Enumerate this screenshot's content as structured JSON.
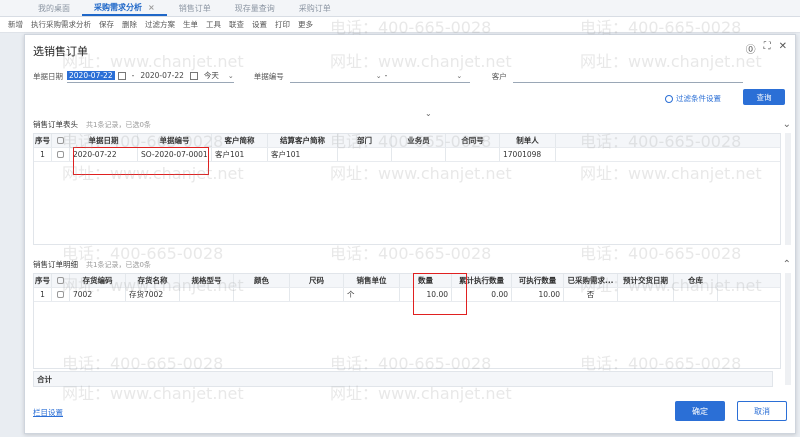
{
  "tabs": [
    {
      "label": "我的桌面"
    },
    {
      "label": "采购需求分析",
      "closable": true
    },
    {
      "label": "销售订单"
    },
    {
      "label": "现存量查询"
    },
    {
      "label": "采购订单"
    }
  ],
  "menubar": [
    "新增",
    "执行采购需求分析",
    "保存",
    "删除",
    "过滤方案",
    "生单",
    "工具",
    "联查",
    "设置",
    "打印",
    "更多"
  ],
  "dialog": {
    "title": "选销售订单",
    "icons": [
      "help-icon",
      "maximize-icon",
      "close-icon"
    ]
  },
  "filter": {
    "date_label": "单据日期",
    "date_from": "2020-07-22",
    "date_sep": "-",
    "date_to": "2020-07-22",
    "range": "今天",
    "billno_label": "单据编号",
    "billno_from": "",
    "billno_sep": "-",
    "customer_label": "客户",
    "advanced": "过滤条件设置",
    "query": "查询"
  },
  "header_section": {
    "title": "销售订单表头",
    "summary": "共1条记录，已选0条",
    "columns": [
      "序号",
      "",
      "单据日期",
      "单据编号",
      "客户简称",
      "结算客户简称",
      "部门",
      "业务员",
      "合同号",
      "制单人"
    ],
    "rows": [
      [
        "1",
        "",
        "2020-07-22",
        "SO-2020-07-0001",
        "客户101",
        "客户101",
        "",
        "",
        "",
        "17001098"
      ]
    ]
  },
  "detail_section": {
    "title": "销售订单明细",
    "summary": "共1条记录，已选0条",
    "columns": [
      "序号",
      "",
      "存货编码",
      "存货名称",
      "规格型号",
      "颜色",
      "尺码",
      "销售单位",
      "数量",
      "累计执行数量",
      "可执行数量",
      "已采购需求...",
      "预计交货日期",
      "仓库"
    ],
    "rows": [
      [
        "1",
        "",
        "7002",
        "存货7002",
        "",
        "",
        "",
        "个",
        "10.00",
        "0.00",
        "10.00",
        "否",
        "",
        ""
      ]
    ],
    "total_label": "合计"
  },
  "footer": {
    "column_settings": "栏目设置",
    "ok": "确定",
    "cancel": "取消"
  },
  "watermarks": {
    "url": "网址：www.chanjet.net",
    "phone": "电话：400-665-0028"
  }
}
